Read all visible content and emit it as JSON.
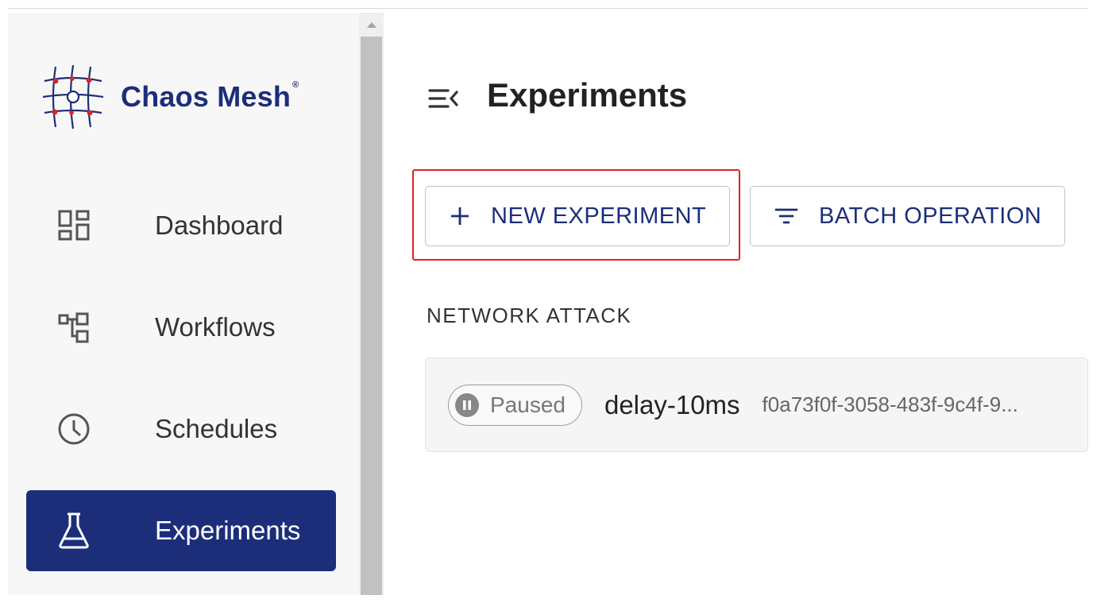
{
  "app": {
    "brand": "Chaos Mesh",
    "brand_mark": "®"
  },
  "sidebar": {
    "items": [
      {
        "label": "Dashboard",
        "icon": "dashboard-icon",
        "active": false
      },
      {
        "label": "Workflows",
        "icon": "workflow-icon",
        "active": false
      },
      {
        "label": "Schedules",
        "icon": "clock-icon",
        "active": false
      },
      {
        "label": "Experiments",
        "icon": "flask-icon",
        "active": true
      }
    ]
  },
  "header": {
    "title": "Experiments"
  },
  "toolbar": {
    "new_label": "NEW EXPERIMENT",
    "batch_label": "BATCH OPERATION"
  },
  "section": {
    "title": "NETWORK ATTACK"
  },
  "experiments": [
    {
      "status": "Paused",
      "name": "delay-10ms",
      "uid": "f0a73f0f-3058-483f-9c4f-9..."
    }
  ],
  "colors": {
    "brand": "#1c2e7a",
    "highlight": "#d9242b",
    "active_nav_bg": "#1c2e7a"
  }
}
